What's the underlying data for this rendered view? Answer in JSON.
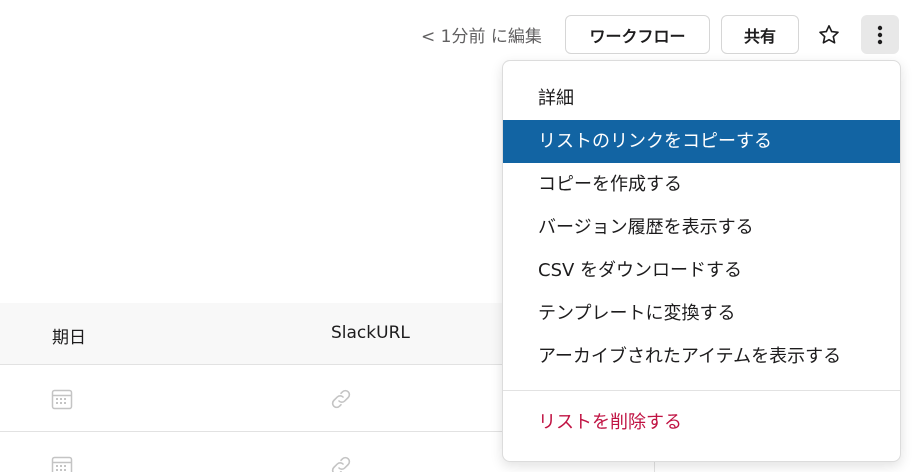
{
  "header": {
    "edited_text": "< 1分前 に編集",
    "workflow_label": "ワークフロー",
    "share_label": "共有"
  },
  "table": {
    "columns": [
      "期日",
      "SlackURL"
    ],
    "rows": [
      {
        "date_icon": "calendar-icon",
        "url_icon": "link-icon"
      },
      {
        "date_icon": "calendar-icon",
        "url_icon": "link-icon"
      }
    ]
  },
  "menu": {
    "items": [
      {
        "label": "詳細"
      },
      {
        "label": "リストのリンクをコピーする",
        "state": "highlighted"
      },
      {
        "label": "コピーを作成する"
      },
      {
        "label": "バージョン履歴を表示する"
      },
      {
        "label": "CSV をダウンロードする"
      },
      {
        "label": "テンプレートに変換する"
      },
      {
        "label": "アーカイブされたアイテムを表示する"
      }
    ],
    "danger_item": {
      "label": "リストを削除する"
    }
  },
  "colors": {
    "highlight": "#1264a3",
    "danger": "#c01343",
    "muted_text": "#616061"
  },
  "icons": {
    "star": "star-icon",
    "more": "more-vertical-icon"
  }
}
